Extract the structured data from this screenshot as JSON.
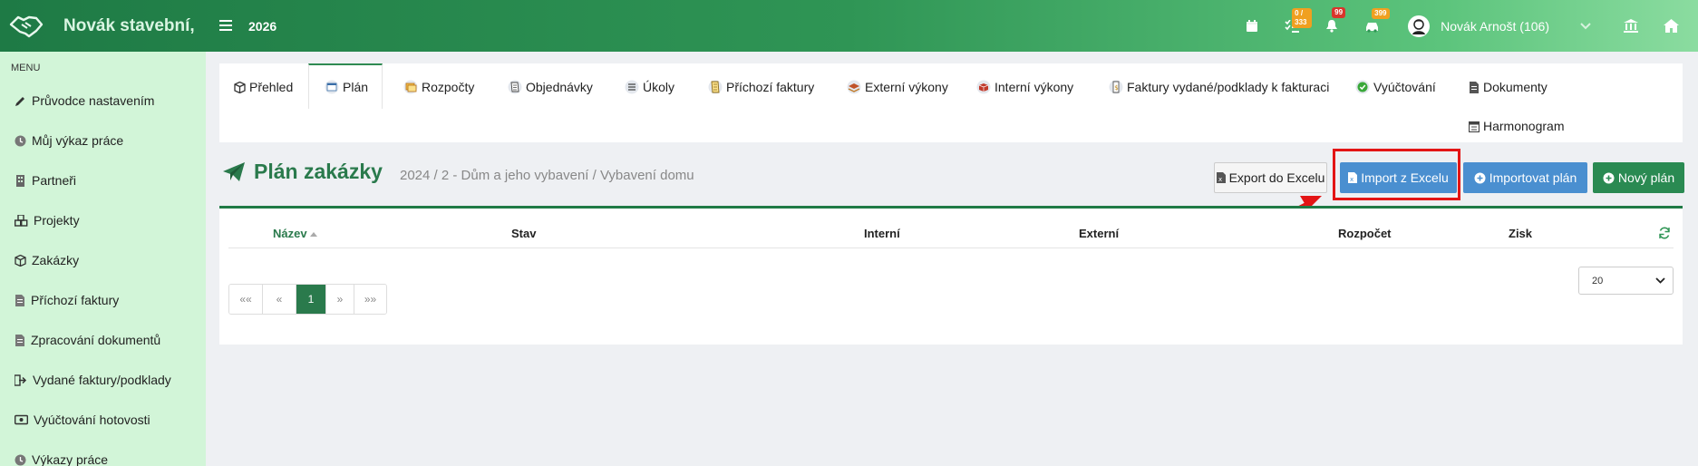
{
  "topbar": {
    "brand": "Novák stavební,",
    "year": "2026",
    "badges": {
      "tasks": "0 / 333",
      "notifications": "99",
      "messages": "399"
    },
    "user_name": "Novák Arnošt (106)"
  },
  "sidebar": {
    "menu_heading": "MENU",
    "items": [
      {
        "label": "Průvodce nastavením",
        "icon": "pencil-icon"
      },
      {
        "label": "Můj výkaz práce",
        "icon": "clock-icon"
      },
      {
        "label": "Partneři",
        "icon": "building-icon"
      },
      {
        "label": "Projekty",
        "icon": "cubes-icon"
      },
      {
        "label": "Zakázky",
        "icon": "cube-icon"
      },
      {
        "label": "Příchozí faktury",
        "icon": "invoice-icon"
      },
      {
        "label": "Zpracování dokumentů",
        "icon": "document-icon"
      },
      {
        "label": "Vydané faktury/podklady",
        "icon": "sign-out-icon"
      },
      {
        "label": "Vyúčtování hotovosti",
        "icon": "money-icon"
      },
      {
        "label": "Výkazy práce",
        "icon": "clock-icon"
      }
    ]
  },
  "tabs": [
    {
      "label": "Přehled"
    },
    {
      "label": "Plán"
    },
    {
      "label": "Rozpočty"
    },
    {
      "label": "Objednávky"
    },
    {
      "label": "Úkoly"
    },
    {
      "label": "Příchozí faktury"
    },
    {
      "label": "Externí výkony"
    },
    {
      "label": "Interní výkony"
    },
    {
      "label": "Faktury vydané/podklady k fakturaci"
    },
    {
      "label": "Vyúčtování"
    },
    {
      "label": "Dokumenty"
    },
    {
      "label": "Harmonogram"
    }
  ],
  "page": {
    "title": "Plán zakázky",
    "subtitle": "2024 / 2 - Dům a jeho vybavení / Vybavení domu"
  },
  "buttons": {
    "export": "Export do Excelu",
    "import": "Import z Excelu",
    "import_plan": "Importovat plán",
    "new_plan": "Nový plán"
  },
  "table": {
    "columns": [
      "Název",
      "Stav",
      "Interní",
      "Externí",
      "Rozpočet",
      "Zisk"
    ]
  },
  "pagination": {
    "first": "««",
    "prev": "«",
    "current": "1",
    "next": "»",
    "last": "»»",
    "page_size": "20"
  },
  "colors": {
    "accent": "#2a7a4c",
    "button_blue": "#4a8fd0",
    "highlight": "#e31515"
  }
}
